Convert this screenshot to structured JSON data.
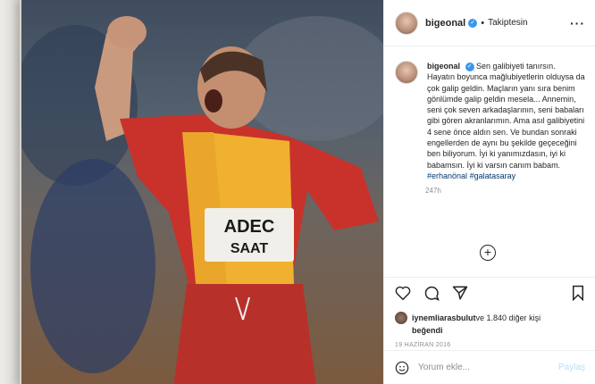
{
  "header": {
    "username": "bigeonal",
    "follow_status": "Takiptesin",
    "more_icon": "more-horizontal-icon"
  },
  "caption": {
    "username": "bigeonal",
    "text": "Sen galibiyeti tanırsın. Hayatın boyunca mağlubiyetlerin olduysa da çok galip geldin. Maçların yanı sıra benim gönlümde galip geldin mesela... Annemin, seni çok seven arkadaşlarının, seni babaları gibi gören akranlarımın. Ama asıl galibiyetini 4 sene önce aldın sen. Ve bundan sonraki engellerden de aynı bu şekilde geçeceğini ben biliyorum. İyi ki yanımızdasın, iyi ki babamsın. İyi ki varsın canım babam.",
    "hashtag1": "#erhanönal",
    "hashtag2": "#galatasaray",
    "time": "247h"
  },
  "likes": {
    "user": "iynemliarasbulut",
    "rest": " ve 1.840 diğer kişi",
    "line2": "beğendi"
  },
  "post_date": "19 HAZİRAN 2016",
  "comment": {
    "placeholder": "Yorum ekle...",
    "post_label": "Paylaş"
  },
  "photo": {
    "jersey_text_1": "ADEC",
    "jersey_text_2": "SAAT"
  },
  "colors": {
    "verified": "#3897f0",
    "link": "#00376b",
    "muted": "#8e8e8e",
    "post_disabled": "#b2dffc",
    "jersey_red": "#c8322b",
    "jersey_yellow": "#f0b030"
  }
}
